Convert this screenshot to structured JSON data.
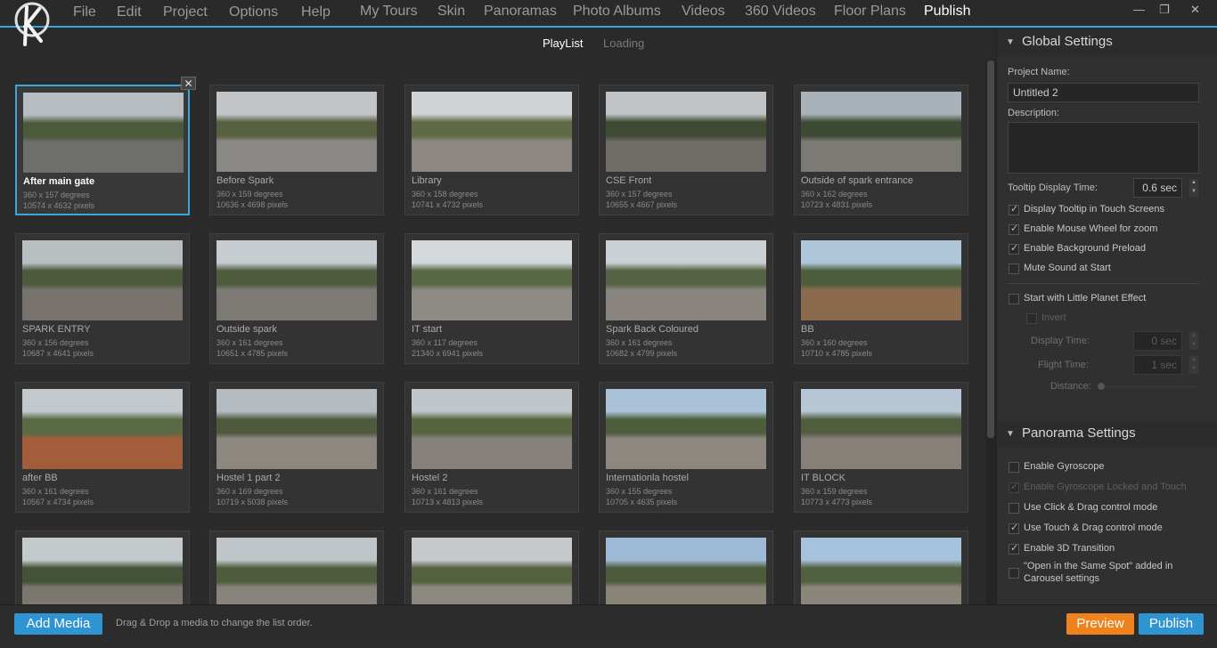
{
  "menu": {
    "items": [
      "File",
      "Edit",
      "Project",
      "Options",
      "Help"
    ],
    "sections": [
      "My Tours",
      "Skin",
      "Panoramas",
      "Photo Albums",
      "Videos",
      "360 Videos",
      "Floor Plans",
      "Publish"
    ],
    "active": "Publish"
  },
  "window_controls": {
    "minimize": "—",
    "restore": "❐",
    "close": "✕"
  },
  "tabs": {
    "playlist": "PlayList",
    "loading": "Loading",
    "active": "PlayList"
  },
  "panoramas": [
    {
      "title": "After main gate",
      "degrees": "360 x 157 degrees",
      "pixels": "10574 x 4632 pixels",
      "selected": true
    },
    {
      "title": "Before Spark",
      "degrees": "360 x 159 degrees",
      "pixels": "10636 x 4698 pixels"
    },
    {
      "title": "Library",
      "degrees": "360 x 158 degrees",
      "pixels": "10741 x 4732 pixels"
    },
    {
      "title": "CSE Front",
      "degrees": "360 x 157 degrees",
      "pixels": "10655 x 4667 pixels"
    },
    {
      "title": "Outside of spark entrance",
      "degrees": "360 x 162 degrees",
      "pixels": "10723 x 4831 pixels"
    },
    {
      "title": "SPARK ENTRY",
      "degrees": "360 x 156 degrees",
      "pixels": "10687 x 4641 pixels"
    },
    {
      "title": "Outside spark",
      "degrees": "360 x 161 degrees",
      "pixels": "10651 x 4785 pixels"
    },
    {
      "title": "IT start",
      "degrees": "360 x 117 degrees",
      "pixels": "21340 x 6941 pixels"
    },
    {
      "title": "Spark Back Coloured",
      "degrees": "360 x 161 degrees",
      "pixels": "10682 x 4799 pixels"
    },
    {
      "title": "BB",
      "degrees": "360 x 160 degrees",
      "pixels": "10710 x 4785 pixels"
    },
    {
      "title": "after BB",
      "degrees": "360 x 161 degrees",
      "pixels": "10567 x 4734 pixels"
    },
    {
      "title": "Hostel 1 part 2",
      "degrees": "360 x 169 degrees",
      "pixels": "10719 x 5038 pixels"
    },
    {
      "title": "Hostel 2",
      "degrees": "360 x 161 degrees",
      "pixels": "10713 x 4813 pixels"
    },
    {
      "title": "Internationla hostel",
      "degrees": "360 x 155 degrees",
      "pixels": "10705 x 4635 pixels"
    },
    {
      "title": "IT BLOCK",
      "degrees": "360 x 159 degrees",
      "pixels": "10773 x 4773 pixels"
    },
    {
      "title": "",
      "degrees": "",
      "pixels": ""
    },
    {
      "title": "",
      "degrees": "",
      "pixels": ""
    },
    {
      "title": "",
      "degrees": "",
      "pixels": ""
    },
    {
      "title": "",
      "degrees": "",
      "pixels": ""
    },
    {
      "title": "",
      "degrees": "",
      "pixels": ""
    }
  ],
  "close_label": "✕",
  "global_settings": {
    "header": "Global Settings",
    "project_name_label": "Project Name:",
    "project_name": "Untitled 2",
    "description_label": "Description:",
    "description": "",
    "tooltip_time_label": "Tooltip Display Time:",
    "tooltip_time": "0.6 sec",
    "options": [
      {
        "label": "Display Tooltip in Touch Screens",
        "checked": true
      },
      {
        "label": "Enable Mouse Wheel for zoom",
        "checked": true
      },
      {
        "label": "Enable Background Preload",
        "checked": true
      },
      {
        "label": "Mute Sound at Start",
        "checked": false
      }
    ],
    "little_planet_label": "Start with Little Planet Effect",
    "invert_label": "Invert",
    "display_time_label": "Display Time:",
    "display_time": "0 sec",
    "flight_time_label": "Flight Time:",
    "flight_time": "1 sec",
    "distance_label": "Distance:"
  },
  "panorama_settings": {
    "header": "Panorama Settings",
    "options": [
      {
        "label": "Enable Gyroscope",
        "checked": false,
        "disabled": false
      },
      {
        "label": "Enable Gyroscope Locked and Touch",
        "checked": true,
        "disabled": true
      },
      {
        "label": "Use Click & Drag control mode",
        "checked": false,
        "disabled": false
      },
      {
        "label": "Use Touch & Drag control mode",
        "checked": true,
        "disabled": false
      },
      {
        "label": "Enable 3D Transition",
        "checked": true,
        "disabled": false
      }
    ],
    "same_spot_line1": "\"Open in the Same Spot\" added in",
    "same_spot_line2": "Carousel settings"
  },
  "bottom": {
    "add_media": "Add Media",
    "hint": "Drag & Drop a media to change the list order.",
    "preview": "Preview",
    "publish": "Publish"
  },
  "colors": {
    "accent_blue": "#2f94d2",
    "preview_orange": "#f0821e",
    "background": "#2b2b2b"
  }
}
